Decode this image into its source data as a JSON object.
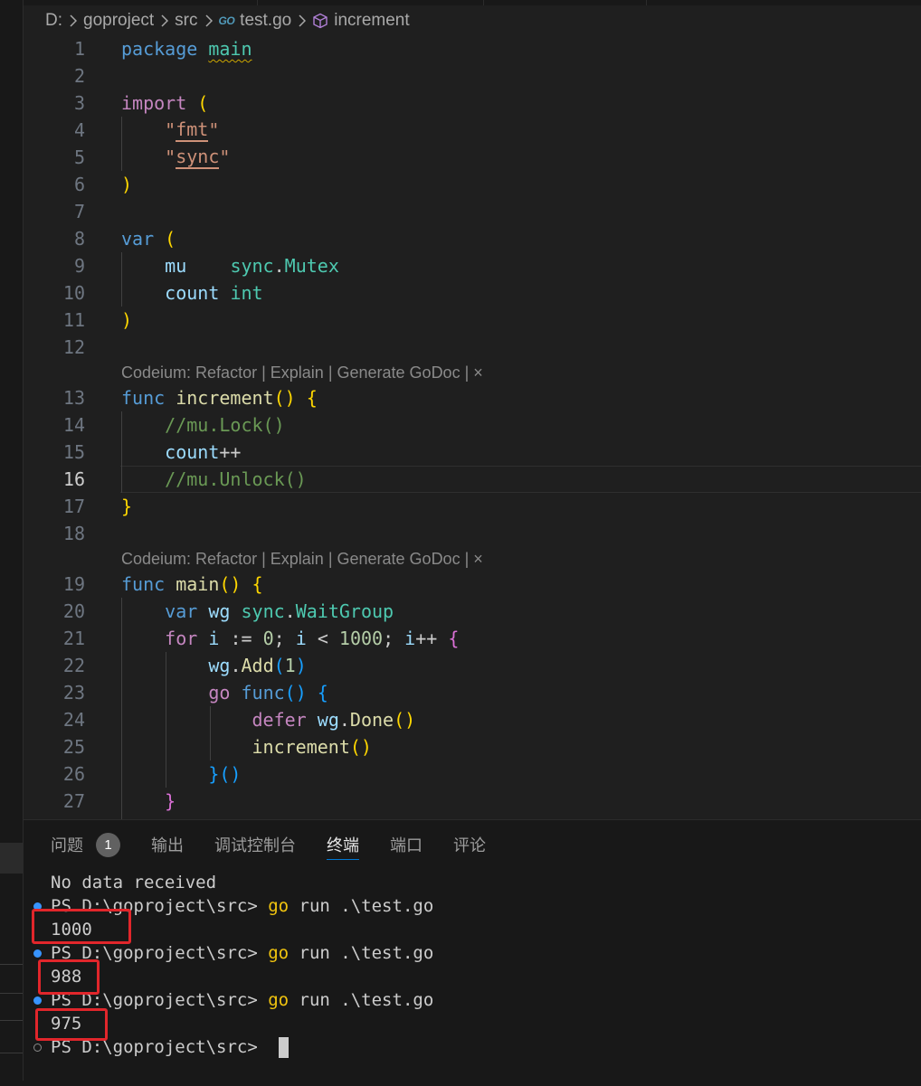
{
  "breadcrumb": {
    "drive": "D:",
    "folder1": "goproject",
    "folder2": "src",
    "file_icon": "go-file-icon",
    "file_icon_text": "GO",
    "file": "test.go",
    "symbol_icon": "cube-symbol-icon",
    "symbol": "increment"
  },
  "editor": {
    "current_line": "16",
    "codelens": {
      "prefix": "Codeium: ",
      "refactor": "Refactor",
      "sep": " | ",
      "explain": "Explain",
      "godoc": "Generate GoDoc",
      "close": "×"
    },
    "lines": [
      {
        "n": "1",
        "code": "package main"
      },
      {
        "n": "2",
        "code": ""
      },
      {
        "n": "3",
        "code": "import ("
      },
      {
        "n": "4",
        "code": "\"fmt\""
      },
      {
        "n": "5",
        "code": "\"sync\""
      },
      {
        "n": "6",
        "code": ")"
      },
      {
        "n": "7",
        "code": ""
      },
      {
        "n": "8",
        "code": "var ("
      },
      {
        "n": "9",
        "code": "mu    sync.Mutex"
      },
      {
        "n": "10",
        "code": "count int"
      },
      {
        "n": "11",
        "code": ")"
      },
      {
        "n": "12",
        "code": ""
      },
      {
        "n": "13",
        "code": "func increment() {"
      },
      {
        "n": "14",
        "code": "//mu.Lock()"
      },
      {
        "n": "15",
        "code": "count++"
      },
      {
        "n": "16",
        "code": "//mu.Unlock()"
      },
      {
        "n": "17",
        "code": "}"
      },
      {
        "n": "18",
        "code": ""
      },
      {
        "n": "19",
        "code": "func main() {"
      },
      {
        "n": "20",
        "code": "var wg sync.WaitGroup"
      },
      {
        "n": "21",
        "code": "for i := 0; i < 1000; i++ {"
      },
      {
        "n": "22",
        "code": "wg.Add(1)"
      },
      {
        "n": "23",
        "code": "go func() {"
      },
      {
        "n": "24",
        "code": "defer wg.Done()"
      },
      {
        "n": "25",
        "code": "increment()"
      },
      {
        "n": "26",
        "code": "}()"
      },
      {
        "n": "27",
        "code": "}"
      }
    ],
    "tokens": {
      "package": "package",
      "main": "main",
      "import": "import",
      "open_paren": "(",
      "close_paren": ")",
      "q": "\"",
      "fmt": "fmt",
      "sync": "sync",
      "var": "var",
      "mu": "mu",
      "sync_pkg": "sync",
      "dot": ".",
      "mutex": "Mutex",
      "count": "count",
      "int": "int",
      "func": "func",
      "increment": "increment",
      "parens": "()",
      "open_brace": "{",
      "close_brace": "}",
      "lock_cmt": "//mu.Lock()",
      "count_inc": "count",
      "plusplus": "++",
      "unlock_cmt": "//mu.Unlock()",
      "main_fn": "main",
      "wg": "wg",
      "waitgroup": "WaitGroup",
      "for": "for",
      "i": "i",
      "assign": ":=",
      "zero": "0",
      "semi": ";",
      "lt": "<",
      "thousand": "1000",
      "ipp": "++",
      "add": "Add",
      "one": "1",
      "go": "go",
      "defer": "defer",
      "done": "Done",
      "space": " ",
      "pad4": "    "
    }
  },
  "panel": {
    "tabs": [
      {
        "label": "问题",
        "badge": "1"
      },
      {
        "label": "输出"
      },
      {
        "label": "调试控制台"
      },
      {
        "label": "终端",
        "active": true
      },
      {
        "label": "端口"
      },
      {
        "label": "评论"
      }
    ],
    "terminal": {
      "first_line": "No data received",
      "prompt": "PS D:\\goproject\\src> ",
      "cmd_go": "go",
      "cmd_rest": " run .\\test.go",
      "outputs": [
        "1000",
        "988",
        "975"
      ]
    }
  },
  "colors": {
    "accent": "#0078d4",
    "highlight_box": "#e1262b",
    "success_deco": "#3794ff"
  }
}
